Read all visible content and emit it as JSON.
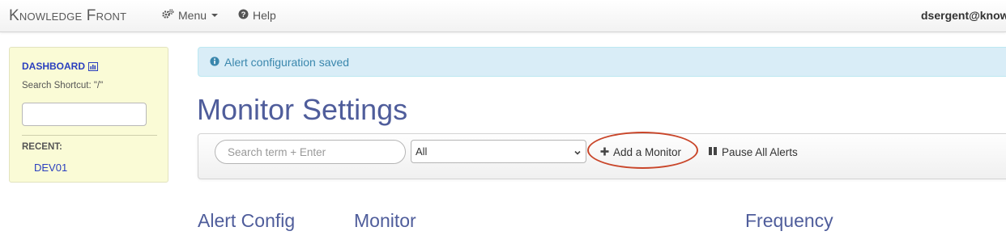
{
  "navbar": {
    "brand": "Knowledge Front",
    "menu_label": "Menu",
    "help_label": "Help",
    "user": "dsergent@know"
  },
  "sidebar": {
    "dashboard_label": "DASHBOARD",
    "search_shortcut": "Search Shortcut: \"/\"",
    "search_value": "",
    "recent_label": "RECENT:",
    "recent_items": [
      {
        "label": "DEV01"
      }
    ]
  },
  "alert": {
    "message": "Alert configuration saved"
  },
  "page": {
    "title": "Monitor Settings"
  },
  "toolbar": {
    "search_placeholder": "Search term + Enter",
    "search_value": "",
    "filter_selected": "All",
    "add_label": "Add a Monitor",
    "pause_label": "Pause All Alerts"
  },
  "table": {
    "columns": [
      "Alert Config",
      "Monitor",
      "Frequency"
    ]
  },
  "colors": {
    "brand_blue": "#4f5d9b",
    "link_blue": "#2a3fbf",
    "sidebar_bg": "#fafbd6",
    "alert_bg": "#d9edf7",
    "alert_text": "#3a87ad",
    "highlight_ring": "#c9462a"
  },
  "icons": {
    "menu": "gears-icon",
    "help": "question-circle-icon",
    "dashboard": "bar-chart-icon",
    "alert": "info-circle-icon",
    "add": "plus-icon",
    "pause": "pause-icon",
    "select": "chevron-down-icon"
  }
}
